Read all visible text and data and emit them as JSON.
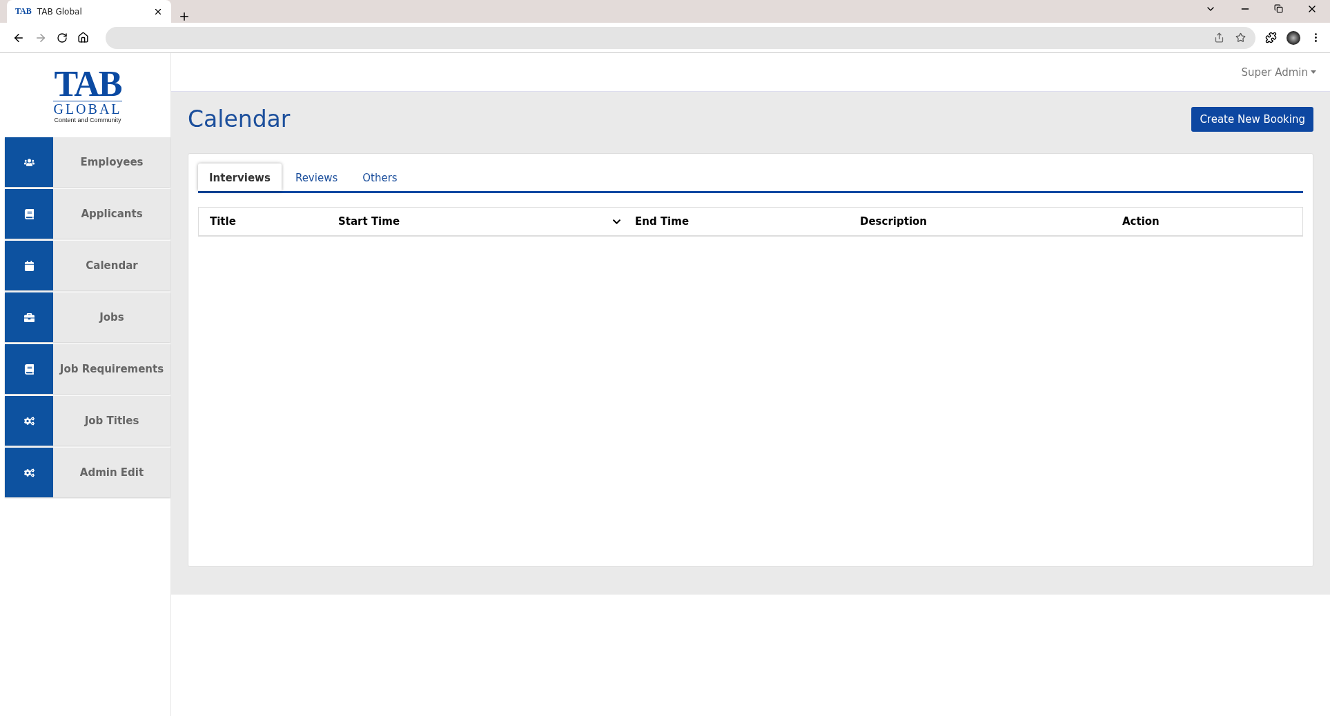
{
  "browser": {
    "tab_title": "TAB Global",
    "logo_text": "TAB"
  },
  "logo": {
    "brand": "TAB",
    "name": "GLOBAL",
    "tagline": "Content and Community"
  },
  "sidebar": {
    "items": [
      {
        "label": "Employees"
      },
      {
        "label": "Applicants"
      },
      {
        "label": "Calendar"
      },
      {
        "label": "Jobs"
      },
      {
        "label": "Job Requirements"
      },
      {
        "label": "Job Titles"
      },
      {
        "label": "Admin Edit"
      }
    ]
  },
  "user_menu": {
    "label": "Super Admin"
  },
  "page": {
    "title": "Calendar",
    "action": "Create New Booking"
  },
  "tabs": [
    {
      "label": "Interviews",
      "selected": true
    },
    {
      "label": "Reviews",
      "selected": false
    },
    {
      "label": "Others",
      "selected": false
    }
  ],
  "table": {
    "columns": [
      {
        "label": "Title",
        "sorted": false
      },
      {
        "label": "Start Time",
        "sorted": true
      },
      {
        "label": "End Time",
        "sorted": false
      },
      {
        "label": "Description",
        "sorted": false
      },
      {
        "label": "Action",
        "sorted": false
      }
    ]
  }
}
